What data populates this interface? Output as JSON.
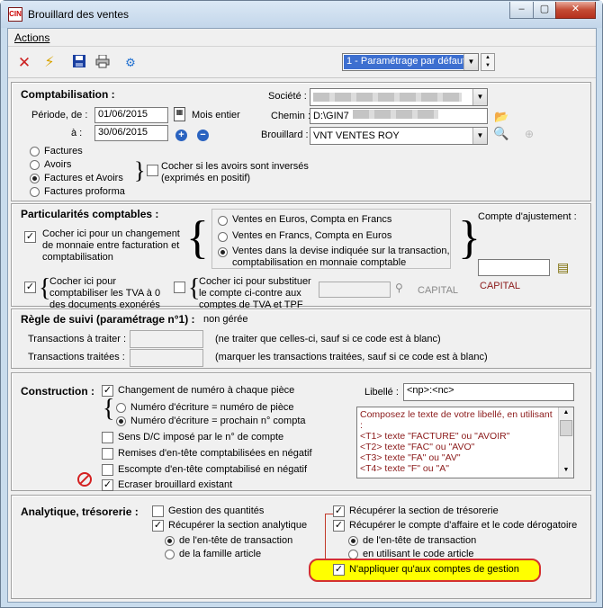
{
  "window": {
    "title": "Brouillard des ventes",
    "app_icon_text": "CIN",
    "controls": [
      "–",
      "▢",
      "✕"
    ]
  },
  "menu": {
    "actions": "Actions"
  },
  "toolbar": {
    "icons": [
      "close-icon",
      "pencil-icon",
      "save-icon",
      "print-icon",
      "settings-icon"
    ],
    "preset": "1 - Paramétrage par défaut"
  },
  "comptabilisation": {
    "title": "Comptabilisation :",
    "periode_label": "Période, de :",
    "date_from": "01/06/2015",
    "mois_entier": "Mois entier",
    "a_label": "à :",
    "date_to": "30/06/2015",
    "societe_label": "Société :",
    "societe_value": "",
    "chemin_label": "Chemin :",
    "chemin_value": "D:\\GIN7",
    "brouillard_label": "Brouillard :",
    "brouillard_value": "VNT VENTES ROY",
    "doc_types": [
      "Factures",
      "Avoirs",
      "Factures et Avoirs",
      "Factures proforma"
    ],
    "doc_type_selected": "Factures et Avoirs",
    "avoirs_inverses": "Cocher si les avoirs sont inversés (exprimés en positif)"
  },
  "particularites": {
    "title": "Particularités comptables :",
    "change_monnaie": "Cocher ici pour un changement de monnaie entre facturation et comptabilisation",
    "options": [
      "Ventes en Euros, Compta en Francs",
      "Ventes en Francs, Compta en Euros",
      "Ventes dans la devise indiquée sur la transaction, comptabilisation en monnaie comptable"
    ],
    "option_selected": 2,
    "compte_ajust_label": "Compte d'ajustement :",
    "compte_ajust_value": "",
    "capital": "CAPITAL",
    "tva_exo": "Cocher ici pour comptabiliser les TVA à 0 des documents exonérés",
    "substituer": "Cocher ici pour substituer le compte ci-contre aux comptes de TVA et TPF",
    "capital2": "CAPITAL"
  },
  "regle": {
    "title": "Règle de suivi (paramétrage n°1) :",
    "status": "non gérée",
    "a_traiter": "Transactions à traiter :",
    "a_traiter_hint": "(ne traiter que celles-ci, sauf si ce code est à blanc)",
    "traitees": "Transactions traitées :",
    "traitees_hint": "(marquer les transactions traitées, sauf si ce code est à blanc)"
  },
  "construction": {
    "title": "Construction :",
    "changement": "Changement de numéro à chaque pièce",
    "radio1": "Numéro d'écriture = numéro de pièce",
    "radio2": "Numéro d'écriture = prochain n° compta",
    "sens": "Sens D/C imposé par le n° de compte",
    "remises": "Remises d'en-tête comptabilisées en négatif",
    "escompte": "Escompte d'en-tête comptabilisé en négatif",
    "ecraser": "Ecraser brouillard existant",
    "libelle_label": "Libellé :",
    "libelle_value": "<np>:<nc>",
    "libelle_help": [
      "Composez le texte de votre libellé, en utilisant :",
      "<T1> texte \"FACTURE\" ou \"AVOIR\"",
      "<T2> texte \"FAC\" ou \"AVO\"",
      "<T3> texte \"FA\" ou \"AV\"",
      "<T4> texte \"F\" ou \"A\""
    ]
  },
  "analytique": {
    "title": "Analytique, trésorerie :",
    "gestion_qte": "Gestion des quantités",
    "recup_analytique": "Récupérer la section analytique",
    "radio_entete": "de l'en-tête de transaction",
    "radio_famille": "de la famille article",
    "recup_tresorerie": "Récupérer la section de trésorerie",
    "recup_affaire": "Récupérer le compte d'affaire et le code dérogatoire",
    "radio_entete2": "de l'en-tête de transaction",
    "radio_code": "en utilisant le code article",
    "appliquer": "N'appliquer qu'aux comptes de gestion"
  }
}
